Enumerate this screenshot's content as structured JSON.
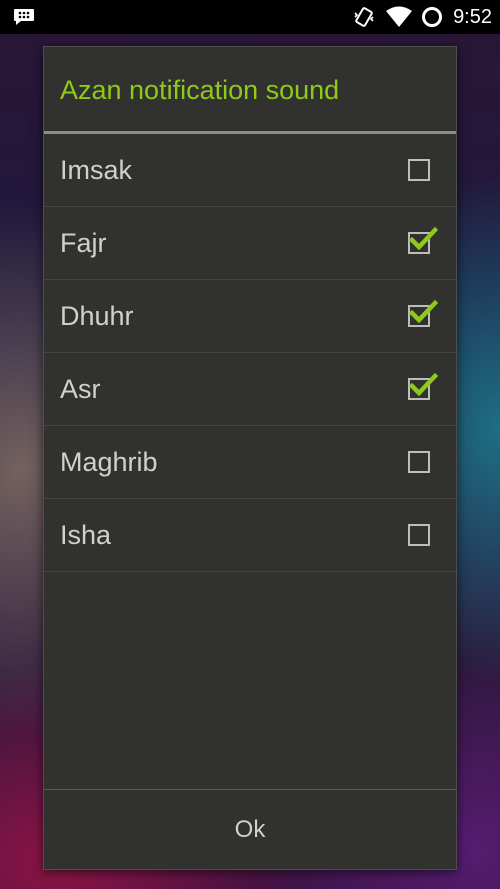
{
  "status_bar": {
    "time": "9:52",
    "icons": [
      "bbm-notification-icon",
      "vibrate-icon",
      "wifi-icon",
      "circle-status-icon"
    ]
  },
  "dialog": {
    "title": "Azan notification sound",
    "items": [
      {
        "label": "Imsak",
        "checked": false
      },
      {
        "label": "Fajr",
        "checked": true
      },
      {
        "label": "Dhuhr",
        "checked": true
      },
      {
        "label": "Asr",
        "checked": true
      },
      {
        "label": "Maghrib",
        "checked": false
      },
      {
        "label": "Isha",
        "checked": false
      }
    ],
    "ok_label": "Ok"
  },
  "colors": {
    "accent": "#8fc919",
    "dialog_bg": "#31322f",
    "text": "#d0d0cc"
  }
}
